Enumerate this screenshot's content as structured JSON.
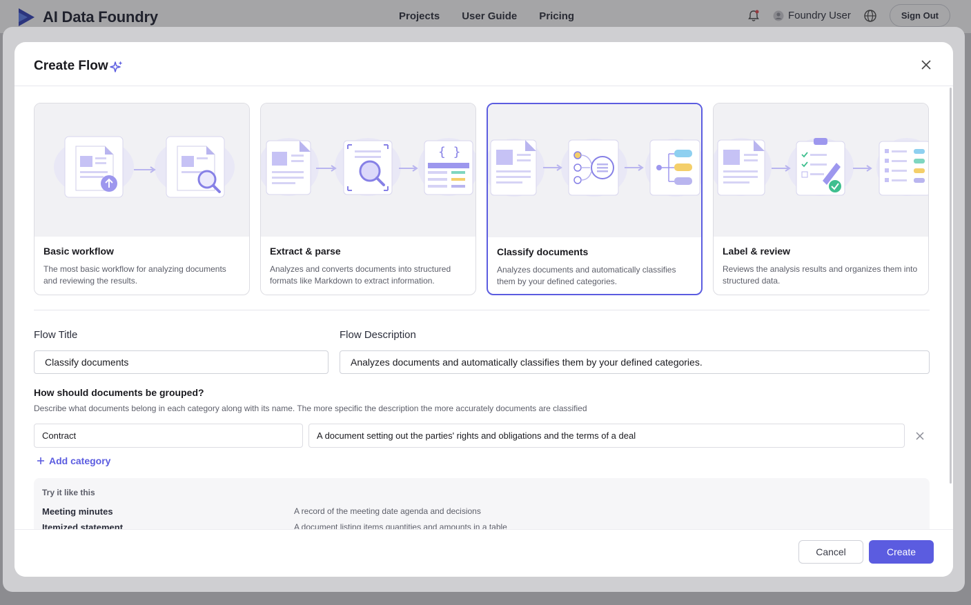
{
  "app": {
    "name": "AI Data Foundry",
    "nav": [
      "Projects",
      "User Guide",
      "Pricing"
    ],
    "user": "Foundry User",
    "sign_out": "Sign Out",
    "brand_color": "#5b5ce0"
  },
  "modal": {
    "title": "Create Flow",
    "templates": [
      {
        "title": "Basic workflow",
        "description": "The most basic workflow for analyzing documents and reviewing the results.",
        "selected": false
      },
      {
        "title": "Extract & parse",
        "description": "Analyzes and converts documents into structured formats like Markdown to extract information.",
        "selected": false
      },
      {
        "title": "Classify documents",
        "description": "Analyzes documents and automatically classifies them by your defined categories.",
        "selected": true
      },
      {
        "title": "Label & review",
        "description": "Reviews the analysis results and organizes them into structured data.",
        "selected": false
      }
    ],
    "form": {
      "title_label": "Flow Title",
      "title_value": "Classify documents",
      "description_label": "Flow Description",
      "description_value": "Analyzes documents and automatically classifies them by your defined categories.",
      "grouping_title": "How should documents be grouped?",
      "grouping_desc": "Describe what documents belong in each category along with its name. The more specific the description the more accurately documents are classified",
      "categories": [
        {
          "name": "Contract",
          "description": "A document setting out the parties' rights and obligations and the terms of a deal"
        }
      ],
      "add_category": "Add category"
    },
    "examples": {
      "title": "Try it like this",
      "items": [
        {
          "name": "Meeting minutes",
          "description": "A record of the meeting date agenda and decisions"
        },
        {
          "name": "Itemized statement",
          "description": "A document listing items quantities and amounts in a table"
        }
      ]
    },
    "buttons": {
      "cancel": "Cancel",
      "create": "Create"
    }
  }
}
